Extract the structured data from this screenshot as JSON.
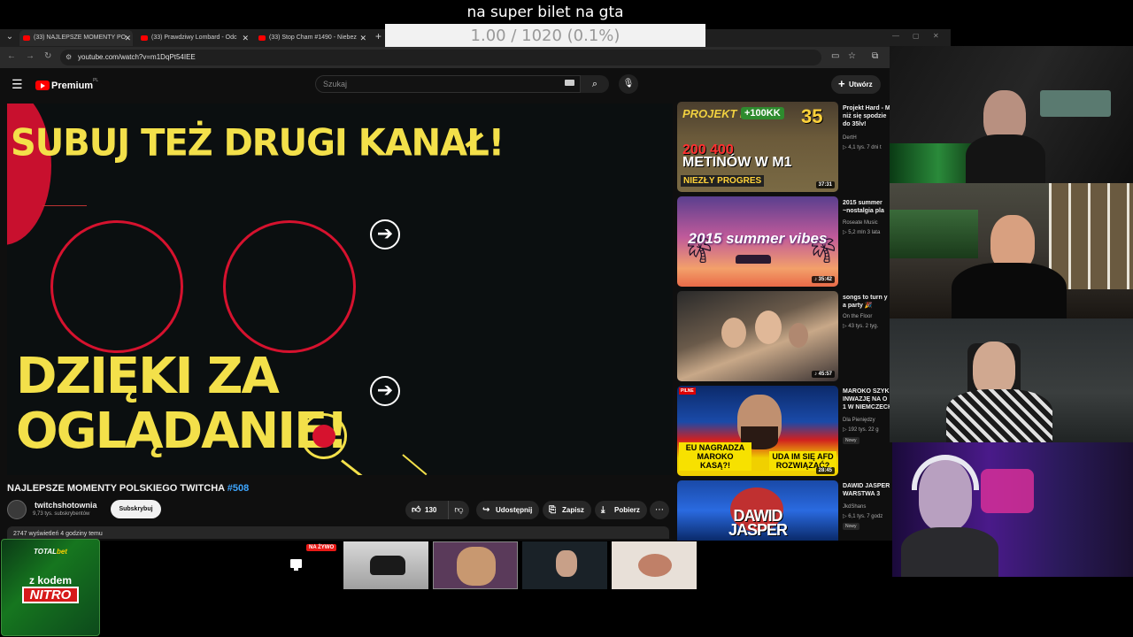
{
  "overlay": {
    "title": "na super bilet na gta",
    "progress": "1.00 / 1020 (0.1%)"
  },
  "browser": {
    "tabs": [
      {
        "label": "(33) NAJLEPSZE MOMENTY PO"
      },
      {
        "label": "(33) Prawdziwy Lombard - Odc"
      },
      {
        "label": "(33) Stop Cham #1490 - Niebez"
      }
    ],
    "url": "youtube.com/watch?v=m1DqPt54IEE"
  },
  "youtube": {
    "logo": "Premium",
    "logo_region": "PL",
    "search_placeholder": "Szukaj",
    "create_label": "Utwórz",
    "video": {
      "line1": "SUBUJ TEŻ DRUGI KANAŁ!",
      "line2a": "DZIĘKI ZA",
      "line2b": "OGLĄDANIE!",
      "arrow1": "➔",
      "arrow2": "➔",
      "title": "NAJLEPSZE MOMENTY POLSKIEGO TWITCHA ",
      "title_tag": "#508",
      "channel": "twitchshotownia",
      "subs": "9,73 tys. subskrybentów",
      "subscribe": "Subskrybuj",
      "likes": "130",
      "share": "Udostępnij",
      "save": "Zapisz",
      "download": "Pobierz",
      "desc": "2747 wyświetleń  4 godziny temu"
    },
    "recs": [
      {
        "title": "Projekt Hard - M",
        "title2": "niż się spodzie",
        "title3": "do 35lv!",
        "channel": "DertH",
        "meta": "▷ 4,1 tys.  7 dni t",
        "duration": "37:31",
        "thumb": {
          "hard": "PROJEKT HARD",
          "k": "+100KK",
          "lvl": "35",
          "big1": "200 ",
          "big1b": "400",
          "big2": "METINÓW W M1",
          "prog": "NIEZŁY PROGRES"
        }
      },
      {
        "title": "2015 summer",
        "title2": "~nostalgia pla",
        "channel": "Roseate Music",
        "meta": "▷ 5,2 mln  3 lata",
        "duration": "♪ 35:42",
        "thumb": {
          "big": "2015 summer vibes"
        }
      },
      {
        "title": "songs to turn y",
        "title2": "a party 🎉",
        "channel": "On the Floor",
        "meta": "▷ 43 tys.  2 tyg.",
        "duration": "♪ 45:57"
      },
      {
        "title": "MAROKO SZYK",
        "title2": "INWAZJĘ NA O",
        "title3": "1 W NIEMCZECH",
        "channel": "Dla Pieniędzy",
        "meta": "▷ 192 tys.  22 g",
        "badge": "Nowy",
        "duration": "28:45",
        "thumb": {
          "pil": "PILNE",
          "l1": "EU NAGRADZA MAROKO KASĄ?!",
          "l2": "UDA IM SIĘ AFD ROZWIĄZAĆ?"
        }
      },
      {
        "title": "DAWID JASPER",
        "title2": "WARSTWA 3",
        "channel": "JkdShans",
        "meta": "▷ 6,1 tys.  7 godz",
        "badge": "Nowy",
        "thumb": {
          "big1": "DAWID",
          "big2": "JASPER"
        }
      }
    ]
  },
  "promo": {
    "brand": "TOTAL",
    "brand2": "bet",
    "code": "z kodem",
    "nitro": "NITRO"
  },
  "strip": {
    "live": "NA ŻYWO"
  }
}
